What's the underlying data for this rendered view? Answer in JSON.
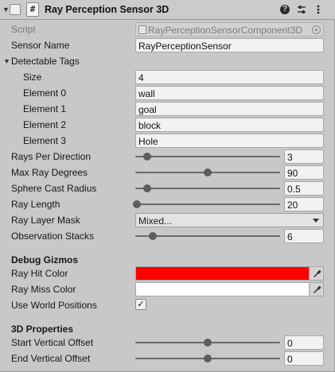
{
  "header": {
    "title": "Ray Perception Sensor 3D",
    "enabled": true,
    "script_glyph": "#",
    "icons": [
      "help-icon",
      "preset-icon",
      "more-options-icon"
    ]
  },
  "script": {
    "label": "Script",
    "value": "RayPerceptionSensorComponent3D"
  },
  "sensor_name": {
    "label": "Sensor Name",
    "value": "RayPerceptionSensor"
  },
  "detectable_tags": {
    "label": "Detectable Tags",
    "expanded": true,
    "size_label": "Size",
    "size": "4",
    "elements": [
      {
        "label": "Element 0",
        "value": "wall"
      },
      {
        "label": "Element 1",
        "value": "goal"
      },
      {
        "label": "Element 2",
        "value": "block"
      },
      {
        "label": "Element 3",
        "value": "Hole"
      }
    ]
  },
  "sliders": [
    {
      "key": "rays",
      "label": "Rays Per Direction",
      "value": "3",
      "fraction": 0.08
    },
    {
      "key": "degrees",
      "label": "Max Ray Degrees",
      "value": "90",
      "fraction": 0.5
    },
    {
      "key": "sphere",
      "label": "Sphere Cast Radius",
      "value": "0.5",
      "fraction": 0.08
    },
    {
      "key": "length",
      "label": "Ray Length",
      "value": "20",
      "fraction": 0.01
    }
  ],
  "ray_layer_mask": {
    "label": "Ray Layer Mask",
    "value": "Mixed..."
  },
  "observation_stacks": {
    "label": "Observation Stacks",
    "value": "6",
    "fraction": 0.12
  },
  "debug_gizmos": {
    "heading": "Debug Gizmos",
    "ray_hit_color": {
      "label": "Ray Hit Color",
      "color": "#ff0000"
    },
    "ray_miss_color": {
      "label": "Ray Miss Color",
      "color": "#ffffff"
    },
    "use_world_positions": {
      "label": "Use World Positions",
      "checked": true,
      "mark": "✓"
    }
  },
  "props_3d": {
    "heading": "3D Properties",
    "start_vertical_offset": {
      "label": "Start Vertical Offset",
      "value": "0",
      "fraction": 0.5
    },
    "end_vertical_offset": {
      "label": "End Vertical Offset",
      "value": "0",
      "fraction": 0.5
    }
  }
}
